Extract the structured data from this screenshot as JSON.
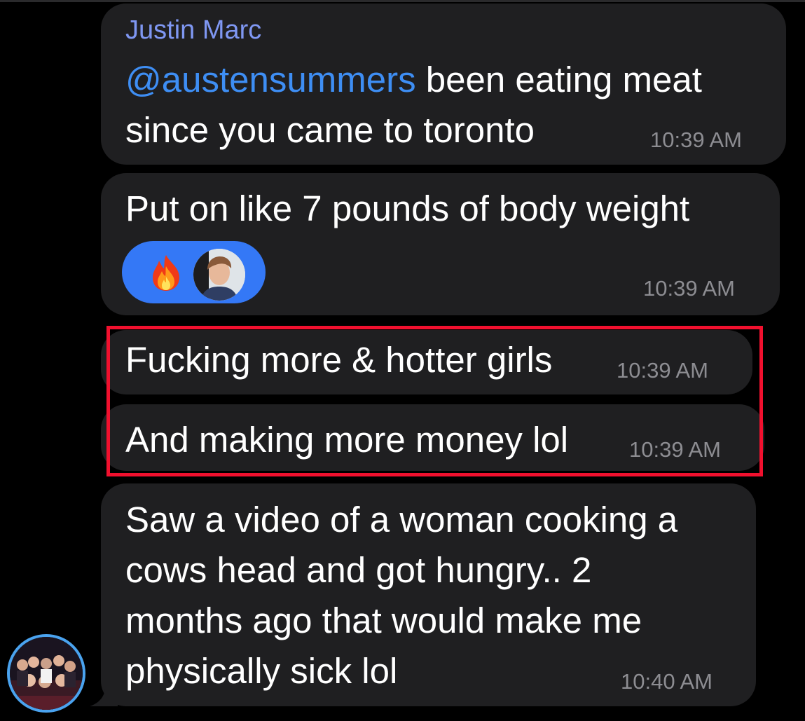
{
  "chat": {
    "sender_name": "Justin Marc",
    "messages": [
      {
        "mention": "@austensummers",
        "lines": [
          " been eating meat",
          "since you came to toronto"
        ],
        "time": "10:39 AM"
      },
      {
        "lines": [
          "Put on like 7 pounds of body weight"
        ],
        "time": "10:39 AM",
        "reactions": [
          {
            "type": "emoji",
            "icon": "fire-emoji"
          },
          {
            "type": "avatar",
            "icon": "reactor-avatar"
          }
        ]
      },
      {
        "lines": [
          "Fucking more & hotter girls"
        ],
        "time": "10:39 AM"
      },
      {
        "lines": [
          "And making more money lol"
        ],
        "time": "10:39 AM"
      },
      {
        "lines": [
          "Saw a video of a woman cooking a",
          "cows head and got hungry.. 2",
          "months ago that would make me",
          "physically sick lol"
        ],
        "time": "10:40 AM"
      }
    ]
  },
  "highlight": {
    "color": "#f1102e"
  },
  "colors": {
    "background": "#000000",
    "bubble": "#1f1f21",
    "sender": "#7f97f2",
    "mention": "#3e8ef4",
    "timestamp": "#8d8d92",
    "reaction_pill": "#3478f6",
    "avatar_ring": "#4aa3ef"
  }
}
